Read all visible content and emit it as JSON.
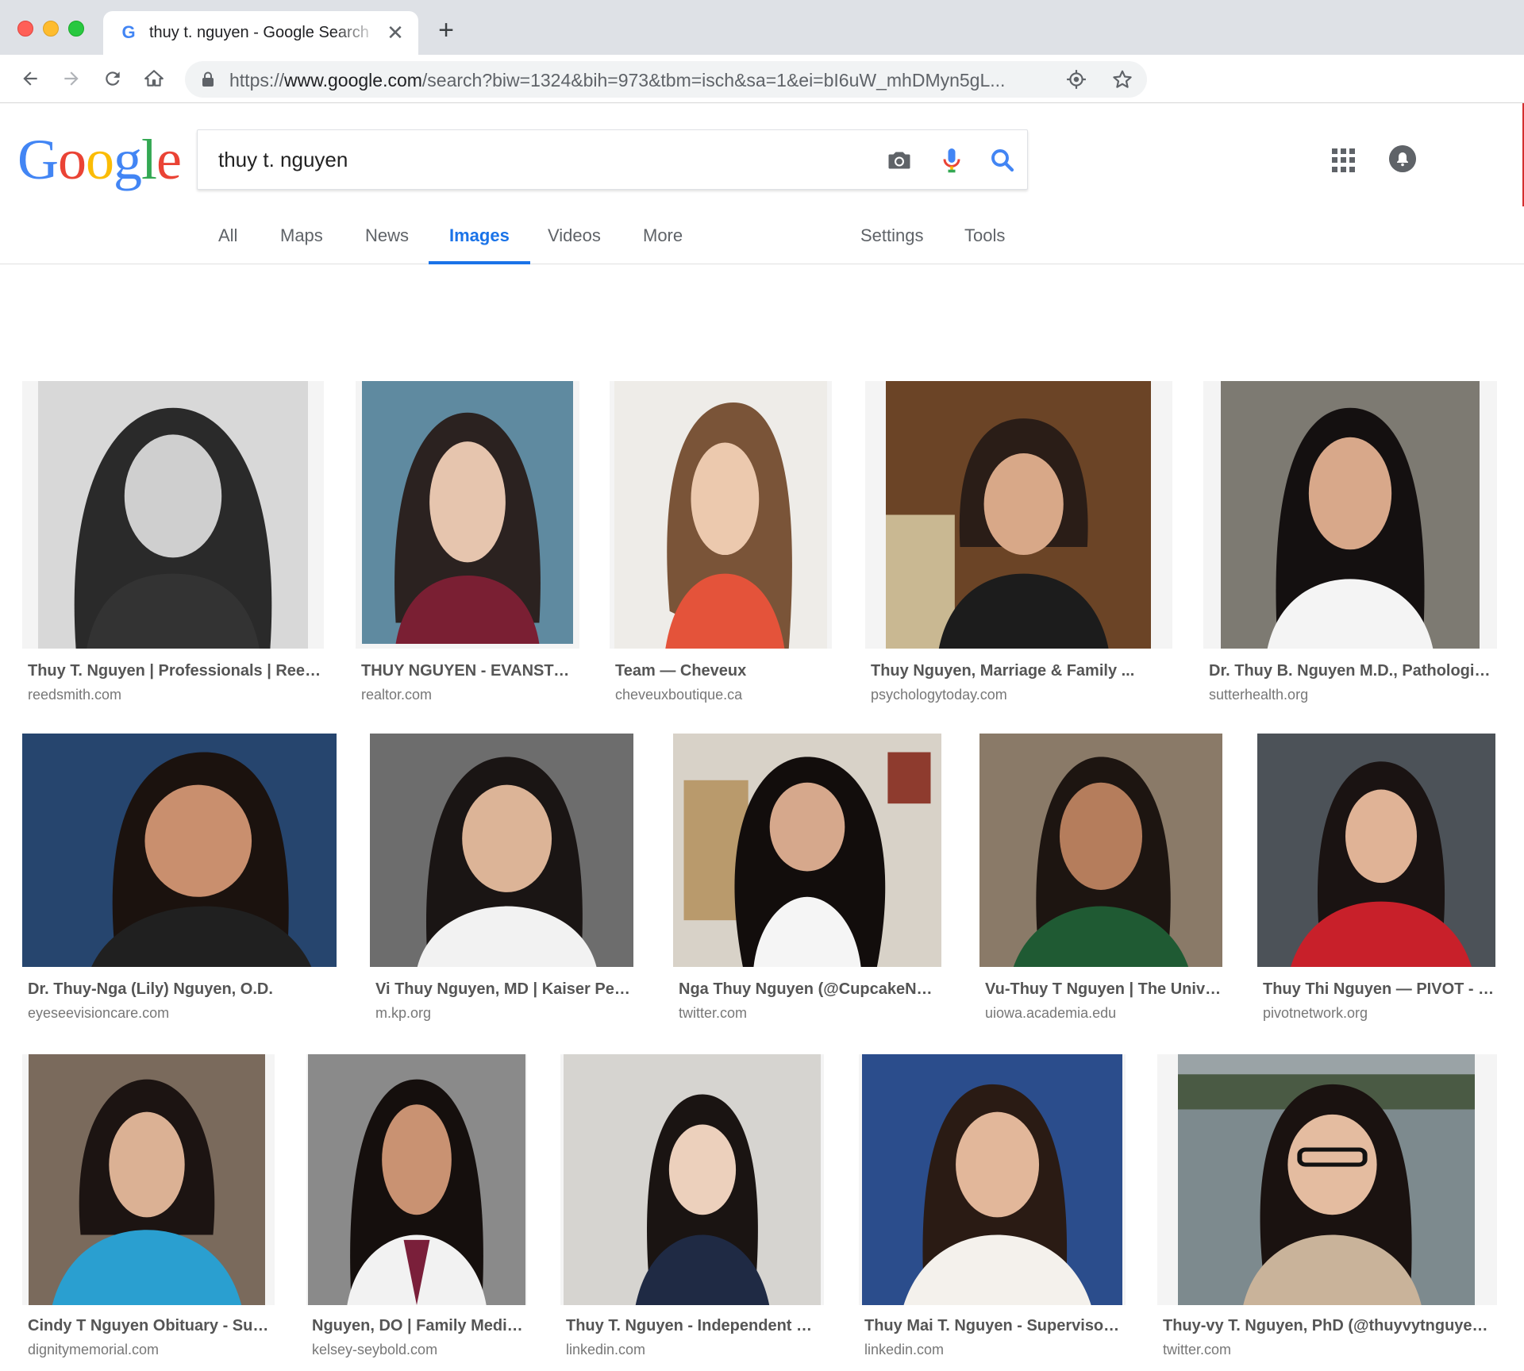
{
  "browser": {
    "tab_title": "thuy t. nguyen - Google Search",
    "tab_favicon": "G",
    "close_glyph": "✕",
    "new_tab_glyph": "+",
    "url_scheme": "https://",
    "url_host": "www.google.com",
    "url_path": "/search?biw=1324&bih=973&tbm=isch&sa=1&ei=bI6uW_mhDMyn5gL...",
    "icons": [
      "back-icon",
      "forward-icon",
      "reload-icon",
      "home-icon",
      "lock-icon",
      "location-icon",
      "star-icon"
    ]
  },
  "google": {
    "logo": [
      "G",
      "o",
      "o",
      "g",
      "l",
      "e"
    ],
    "search_value": "thuy t. nguyen",
    "tabs": [
      {
        "label": "All"
      },
      {
        "label": "Maps"
      },
      {
        "label": "News"
      },
      {
        "label": "Images",
        "active": true
      },
      {
        "label": "Videos"
      },
      {
        "label": "More"
      }
    ],
    "settings_label": "Settings",
    "tools_label": "Tools",
    "colors": {
      "blue": "#4285f4",
      "red": "#ea4335",
      "yellow": "#fbbc05",
      "green": "#34a853",
      "active_tab": "#1a73e8"
    }
  },
  "results": [
    {
      "caption": "Thuy T. Nguyen | Professionals | Reed ...",
      "source": "reedsmith.com"
    },
    {
      "caption": "THUY NGUYEN - EVANSTO...",
      "source": "realtor.com"
    },
    {
      "caption": "Team — Cheveux",
      "source": "cheveuxboutique.ca"
    },
    {
      "caption": "Thuy Nguyen, Marriage & Family ...",
      "source": "psychologytoday.com"
    },
    {
      "caption": "Dr. Thuy B. Nguyen M.D., Pathologist...",
      "source": "sutterhealth.org"
    },
    {
      "caption": "Dr. Thuy-Nga (Lily) Nguyen, O.D.",
      "source": "eyeseevisioncare.com"
    },
    {
      "caption": "Vi Thuy Nguyen, MD | Kaiser Per...",
      "source": "m.kp.org"
    },
    {
      "caption": "Nga Thuy Nguyen (@CupcakeNga) ...",
      "source": "twitter.com"
    },
    {
      "caption": "Vu-Thuy T Nguyen | The Unive...",
      "source": "uiowa.academia.edu"
    },
    {
      "caption": "Thuy Thi Nguyen — PIVOT - T...",
      "source": "pivotnetwork.org"
    },
    {
      "caption": "Cindy T Nguyen Obituary - Sud...",
      "source": "dignitymemorial.com"
    },
    {
      "caption": "Nguyen, DO | Family Medici...",
      "source": "kelsey-seybold.com"
    },
    {
      "caption": "Thuy T. Nguyen - Independent Gr...",
      "source": "linkedin.com"
    },
    {
      "caption": "Thuy Mai T. Nguyen - Supervisor ...",
      "source": "linkedin.com"
    },
    {
      "caption": "Thuy-vy T. Nguyen, PhD (@thuyvytnguyen ...",
      "source": "twitter.com"
    }
  ]
}
